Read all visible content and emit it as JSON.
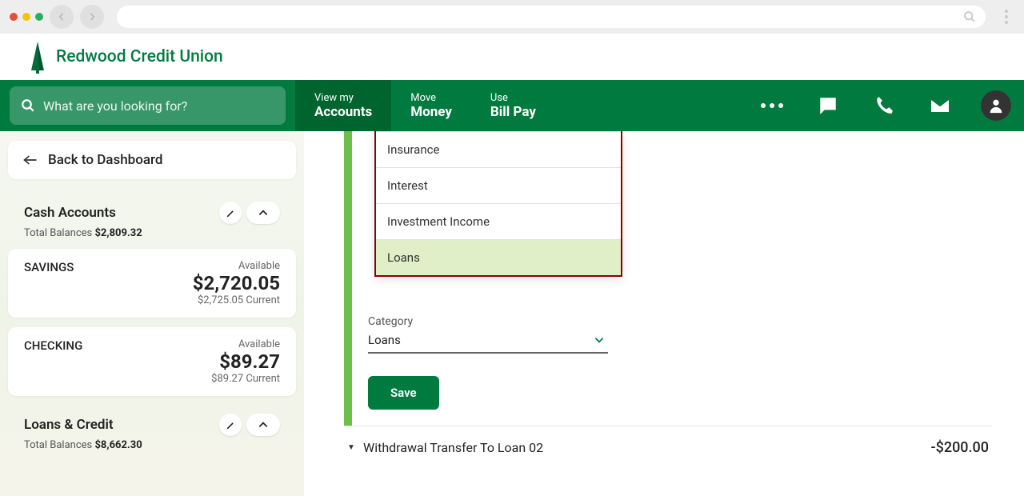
{
  "logo": {
    "brand": "Redwood Credit Union"
  },
  "search": {
    "placeholder": "What are you looking for?"
  },
  "nav": {
    "tabs": [
      {
        "small": "View my",
        "big": "Accounts"
      },
      {
        "small": "Move",
        "big": "Money"
      },
      {
        "small": "Use",
        "big": "Bill Pay"
      }
    ]
  },
  "sidebar": {
    "back": "Back to Dashboard",
    "sections": [
      {
        "title": "Cash Accounts",
        "sub_label": "Total Balances ",
        "sub_value": "$2,809.32",
        "accounts": [
          {
            "name": "SAVINGS",
            "available_label": "Available",
            "available": "$2,720.05",
            "current": "$2,725.05 Current"
          },
          {
            "name": "CHECKING",
            "available_label": "Available",
            "available": "$89.27",
            "current": "$89.27 Current"
          }
        ]
      },
      {
        "title": "Loans & Credit",
        "sub_label": "Total Balances ",
        "sub_value": "$8,662.30"
      }
    ]
  },
  "main": {
    "category_label": "Category",
    "category_value": "Loans",
    "save_label": "Save",
    "dropdown_items": [
      "Insurance",
      "Interest",
      "Investment Income",
      "Loans"
    ],
    "transaction": {
      "desc": "Withdrawal Transfer To Loan 02",
      "amount": "-$200.00"
    }
  }
}
